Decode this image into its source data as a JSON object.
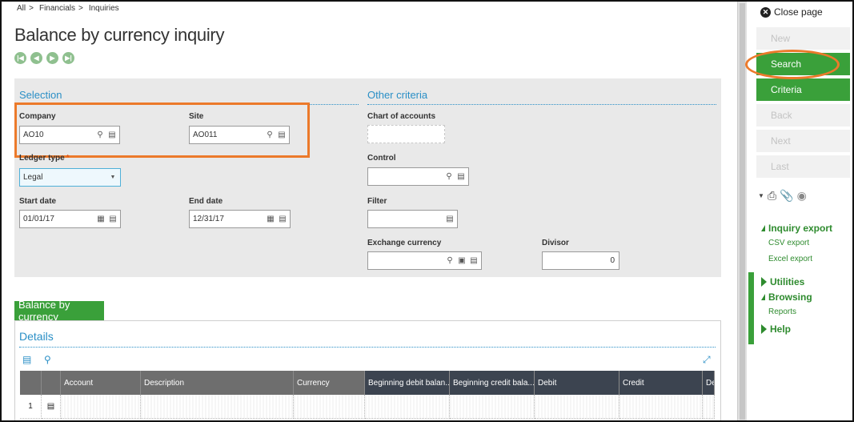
{
  "breadcrumb": [
    "All",
    "Financials",
    "Inquiries"
  ],
  "breadcrumb_sep": ">",
  "page_title": "Balance by currency inquiry",
  "nav_arrows": [
    "first",
    "previous",
    "next",
    "last"
  ],
  "selection": {
    "heading": "Selection",
    "company": {
      "label": "Company",
      "value": "AO10"
    },
    "site": {
      "label": "Site",
      "value": "AO011"
    },
    "ledger_type": {
      "label": "Ledger type",
      "required_mark": "*",
      "value": "Legal"
    },
    "start_date": {
      "label": "Start date",
      "value": "01/01/17"
    },
    "end_date": {
      "label": "End date",
      "value": "12/31/17"
    }
  },
  "other_criteria": {
    "heading": "Other criteria",
    "chart_of_accounts": {
      "label": "Chart of accounts",
      "value": ""
    },
    "control": {
      "label": "Control",
      "value": ""
    },
    "filter": {
      "label": "Filter",
      "value": ""
    },
    "exchange_currency": {
      "label": "Exchange currency",
      "value": ""
    },
    "divisor": {
      "label": "Divisor",
      "value": "0"
    }
  },
  "tab_label": "Balance by currency",
  "details": {
    "heading": "Details",
    "columns": [
      "Account",
      "Description",
      "Currency",
      "Beginning debit balan...",
      "Beginning credit bala...",
      "Debit",
      "Credit",
      "De"
    ],
    "rows": [
      {
        "num": "1"
      }
    ]
  },
  "right_panel": {
    "close_page": "Close page",
    "actions": [
      {
        "label": "New",
        "state": "disabled"
      },
      {
        "label": "Search",
        "state": "active"
      },
      {
        "label": "Criteria",
        "state": "active"
      },
      {
        "label": "Back",
        "state": "disabled"
      },
      {
        "label": "Next",
        "state": "disabled"
      },
      {
        "label": "Last",
        "state": "disabled"
      }
    ],
    "inquiry_export": {
      "label": "Inquiry export",
      "links": [
        "CSV export",
        "Excel export"
      ]
    },
    "utilities": "Utilities",
    "browsing": {
      "label": "Browsing",
      "links": [
        "Reports"
      ]
    },
    "help": "Help"
  },
  "colors": {
    "accent_green": "#3aa03a",
    "accent_blue": "#2a8fc6",
    "highlight_orange": "#ec7a2b"
  }
}
